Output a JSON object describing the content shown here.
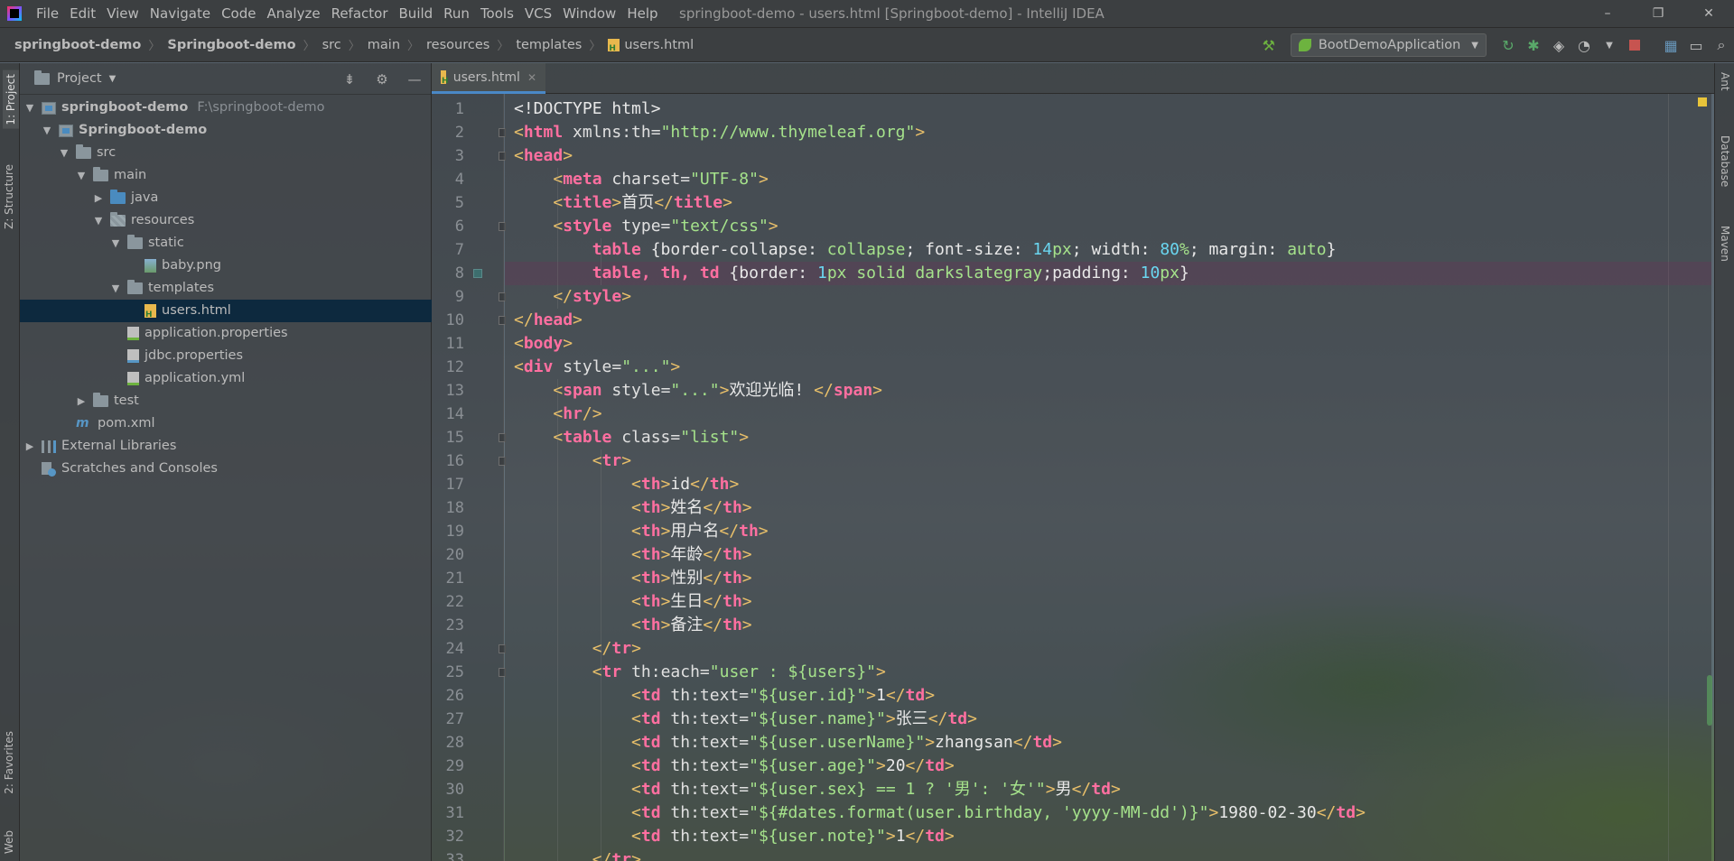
{
  "titlebar": {
    "menu": [
      "File",
      "Edit",
      "View",
      "Navigate",
      "Code",
      "Analyze",
      "Refactor",
      "Build",
      "Run",
      "Tools",
      "VCS",
      "Window",
      "Help"
    ],
    "window_title": "springboot-demo - users.html [Springboot-demo] - IntelliJ IDEA",
    "controls": [
      "–",
      "❐",
      "✕"
    ]
  },
  "breadcrumbs": [
    "springboot-demo",
    "Springboot-demo",
    "src",
    "main",
    "resources",
    "templates",
    "users.html"
  ],
  "run_config": {
    "label": "BootDemoApplication"
  },
  "toolbar_icons": [
    "build-hammer-icon",
    "rerun-icon",
    "debug-icon",
    "coverage-icon",
    "profile-icon",
    "stop-icon",
    "project-structure-icon",
    "window-layout-icon",
    "search-icon"
  ],
  "left_tabs": {
    "project": "1: Project",
    "structure": "Z: Structure",
    "favorites": "2: Favorites",
    "web": "Web"
  },
  "right_tabs": {
    "ant": "Ant",
    "database": "Database",
    "maven": "Maven"
  },
  "project_panel": {
    "title": "Project",
    "tree": [
      {
        "label": "springboot-demo",
        "hint": "F:\\springboot-demo",
        "depth": 0,
        "arrow": "▼",
        "icon": "module",
        "bold": true
      },
      {
        "label": "Springboot-demo",
        "depth": 1,
        "arrow": "▼",
        "icon": "module",
        "bold": true
      },
      {
        "label": "src",
        "depth": 2,
        "arrow": "▼",
        "icon": "folder"
      },
      {
        "label": "main",
        "depth": 3,
        "arrow": "▼",
        "icon": "folder"
      },
      {
        "label": "java",
        "depth": 4,
        "arrow": "▶",
        "icon": "folder-blue"
      },
      {
        "label": "resources",
        "depth": 4,
        "arrow": "▼",
        "icon": "folder-res"
      },
      {
        "label": "static",
        "depth": 5,
        "arrow": "▼",
        "icon": "folder"
      },
      {
        "label": "baby.png",
        "depth": 6,
        "arrow": "",
        "icon": "file-img"
      },
      {
        "label": "templates",
        "depth": 5,
        "arrow": "▼",
        "icon": "folder"
      },
      {
        "label": "users.html",
        "depth": 6,
        "arrow": "",
        "icon": "file-html",
        "selected": true
      },
      {
        "label": "application.properties",
        "depth": 5,
        "arrow": "",
        "icon": "file-prop"
      },
      {
        "label": "jdbc.properties",
        "depth": 5,
        "arrow": "",
        "icon": "file-prop2"
      },
      {
        "label": "application.yml",
        "depth": 5,
        "arrow": "",
        "icon": "file-yml"
      },
      {
        "label": "test",
        "depth": 3,
        "arrow": "▶",
        "icon": "folder"
      },
      {
        "label": "pom.xml",
        "depth": 2,
        "arrow": "",
        "icon": "maven"
      },
      {
        "label": "External Libraries",
        "depth": 0,
        "arrow": "▶",
        "icon": "libs"
      },
      {
        "label": "Scratches and Consoles",
        "depth": 0,
        "arrow": "",
        "icon": "scratch"
      }
    ]
  },
  "editor": {
    "tab_label": "users.html",
    "current_line": 8,
    "lines": [
      [
        [
          "<!DOCTYPE html>",
          "pu"
        ]
      ],
      [
        [
          "<",
          "t"
        ],
        [
          "html",
          "tn"
        ],
        [
          " xmlns:th=",
          "at"
        ],
        [
          "\"http://www.thymeleaf.org\"",
          "av"
        ],
        [
          ">",
          "t"
        ]
      ],
      [
        [
          "<",
          "t"
        ],
        [
          "head",
          "tn"
        ],
        [
          ">",
          "t"
        ]
      ],
      [
        [
          "    <",
          "t"
        ],
        [
          "meta",
          "tn"
        ],
        [
          " charset=",
          "at"
        ],
        [
          "\"UTF-8\"",
          "av"
        ],
        [
          ">",
          "t"
        ]
      ],
      [
        [
          "    <",
          "t"
        ],
        [
          "title",
          "tn"
        ],
        [
          ">",
          "t"
        ],
        [
          "首页",
          "pu"
        ],
        [
          "</",
          "t"
        ],
        [
          "title",
          "tn"
        ],
        [
          ">",
          "t"
        ]
      ],
      [
        [
          "    <",
          "t"
        ],
        [
          "style",
          "tn"
        ],
        [
          " type=",
          "at"
        ],
        [
          "\"text/css\"",
          "av"
        ],
        [
          ">",
          "t"
        ]
      ],
      [
        [
          "        table ",
          "tn"
        ],
        [
          "{border-collapse: ",
          "pu"
        ],
        [
          "collapse",
          "av"
        ],
        [
          "; font-size: ",
          "pu"
        ],
        [
          "14",
          "nm"
        ],
        [
          "px",
          "av"
        ],
        [
          "; width: ",
          "pu"
        ],
        [
          "80",
          "nm"
        ],
        [
          "%",
          "av"
        ],
        [
          "; margin: ",
          "pu"
        ],
        [
          "auto",
          "av"
        ],
        [
          "}",
          "pu"
        ]
      ],
      [
        [
          "        table, th, td ",
          "tn"
        ],
        [
          "{border: ",
          "pu"
        ],
        [
          "1",
          "nm"
        ],
        [
          "px solid darkslategray",
          "av"
        ],
        [
          ";padding: ",
          "pu"
        ],
        [
          "10",
          "nm"
        ],
        [
          "px",
          "av"
        ],
        [
          "}",
          "pu"
        ]
      ],
      [
        [
          "    </",
          "t"
        ],
        [
          "style",
          "tn"
        ],
        [
          ">",
          "t"
        ]
      ],
      [
        [
          "</",
          "t"
        ],
        [
          "head",
          "tn"
        ],
        [
          ">",
          "t"
        ]
      ],
      [
        [
          "<",
          "t"
        ],
        [
          "body",
          "tn"
        ],
        [
          ">",
          "t"
        ]
      ],
      [
        [
          "<",
          "t"
        ],
        [
          "div",
          "tn"
        ],
        [
          " style=",
          "at"
        ],
        [
          "\"...\"",
          "av"
        ],
        [
          ">",
          "t"
        ]
      ],
      [
        [
          "    <",
          "t"
        ],
        [
          "span",
          "tn"
        ],
        [
          " style=",
          "at"
        ],
        [
          "\"...\"",
          "av"
        ],
        [
          ">",
          "t"
        ],
        [
          "欢迎光临! ",
          "pu"
        ],
        [
          "</",
          "t"
        ],
        [
          "span",
          "tn"
        ],
        [
          ">",
          "t"
        ]
      ],
      [
        [
          "    <",
          "t"
        ],
        [
          "hr",
          "tn"
        ],
        [
          "/>",
          "t"
        ]
      ],
      [
        [
          "    <",
          "t"
        ],
        [
          "table",
          "tn"
        ],
        [
          " class=",
          "at"
        ],
        [
          "\"list\"",
          "av"
        ],
        [
          ">",
          "t"
        ]
      ],
      [
        [
          "        <",
          "t"
        ],
        [
          "tr",
          "tn"
        ],
        [
          ">",
          "t"
        ]
      ],
      [
        [
          "            <",
          "t"
        ],
        [
          "th",
          "tn"
        ],
        [
          ">",
          "t"
        ],
        [
          "id",
          "pu"
        ],
        [
          "</",
          "t"
        ],
        [
          "th",
          "tn"
        ],
        [
          ">",
          "t"
        ]
      ],
      [
        [
          "            <",
          "t"
        ],
        [
          "th",
          "tn"
        ],
        [
          ">",
          "t"
        ],
        [
          "姓名",
          "pu"
        ],
        [
          "</",
          "t"
        ],
        [
          "th",
          "tn"
        ],
        [
          ">",
          "t"
        ]
      ],
      [
        [
          "            <",
          "t"
        ],
        [
          "th",
          "tn"
        ],
        [
          ">",
          "t"
        ],
        [
          "用户名",
          "pu"
        ],
        [
          "</",
          "t"
        ],
        [
          "th",
          "tn"
        ],
        [
          ">",
          "t"
        ]
      ],
      [
        [
          "            <",
          "t"
        ],
        [
          "th",
          "tn"
        ],
        [
          ">",
          "t"
        ],
        [
          "年龄",
          "pu"
        ],
        [
          "</",
          "t"
        ],
        [
          "th",
          "tn"
        ],
        [
          ">",
          "t"
        ]
      ],
      [
        [
          "            <",
          "t"
        ],
        [
          "th",
          "tn"
        ],
        [
          ">",
          "t"
        ],
        [
          "性别",
          "pu"
        ],
        [
          "</",
          "t"
        ],
        [
          "th",
          "tn"
        ],
        [
          ">",
          "t"
        ]
      ],
      [
        [
          "            <",
          "t"
        ],
        [
          "th",
          "tn"
        ],
        [
          ">",
          "t"
        ],
        [
          "生日",
          "pu"
        ],
        [
          "</",
          "t"
        ],
        [
          "th",
          "tn"
        ],
        [
          ">",
          "t"
        ]
      ],
      [
        [
          "            <",
          "t"
        ],
        [
          "th",
          "tn"
        ],
        [
          ">",
          "t"
        ],
        [
          "备注",
          "pu"
        ],
        [
          "</",
          "t"
        ],
        [
          "th",
          "tn"
        ],
        [
          ">",
          "t"
        ]
      ],
      [
        [
          "        </",
          "t"
        ],
        [
          "tr",
          "tn"
        ],
        [
          ">",
          "t"
        ]
      ],
      [
        [
          "        <",
          "t"
        ],
        [
          "tr",
          "tn"
        ],
        [
          " th:each=",
          "at"
        ],
        [
          "\"user : ${users}\"",
          "av"
        ],
        [
          ">",
          "t"
        ]
      ],
      [
        [
          "            <",
          "t"
        ],
        [
          "td",
          "tn"
        ],
        [
          " th:text=",
          "at"
        ],
        [
          "\"${user.id}\"",
          "av"
        ],
        [
          ">",
          "t"
        ],
        [
          "1",
          "pu"
        ],
        [
          "</",
          "t"
        ],
        [
          "td",
          "tn"
        ],
        [
          ">",
          "t"
        ]
      ],
      [
        [
          "            <",
          "t"
        ],
        [
          "td",
          "tn"
        ],
        [
          " th:text=",
          "at"
        ],
        [
          "\"${user.name}\"",
          "av"
        ],
        [
          ">",
          "t"
        ],
        [
          "张三",
          "pu"
        ],
        [
          "</",
          "t"
        ],
        [
          "td",
          "tn"
        ],
        [
          ">",
          "t"
        ]
      ],
      [
        [
          "            <",
          "t"
        ],
        [
          "td",
          "tn"
        ],
        [
          " th:text=",
          "at"
        ],
        [
          "\"${user.userName}\"",
          "av"
        ],
        [
          ">",
          "t"
        ],
        [
          "zhangsan",
          "pu"
        ],
        [
          "</",
          "t"
        ],
        [
          "td",
          "tn"
        ],
        [
          ">",
          "t"
        ]
      ],
      [
        [
          "            <",
          "t"
        ],
        [
          "td",
          "tn"
        ],
        [
          " th:text=",
          "at"
        ],
        [
          "\"${user.age}\"",
          "av"
        ],
        [
          ">",
          "t"
        ],
        [
          "20",
          "pu"
        ],
        [
          "</",
          "t"
        ],
        [
          "td",
          "tn"
        ],
        [
          ">",
          "t"
        ]
      ],
      [
        [
          "            <",
          "t"
        ],
        [
          "td",
          "tn"
        ],
        [
          " th:text=",
          "at"
        ],
        [
          "\"${user.sex} == 1 ? '男': '女'\"",
          "av"
        ],
        [
          ">",
          "t"
        ],
        [
          "男",
          "pu"
        ],
        [
          "</",
          "t"
        ],
        [
          "td",
          "tn"
        ],
        [
          ">",
          "t"
        ]
      ],
      [
        [
          "            <",
          "t"
        ],
        [
          "td",
          "tn"
        ],
        [
          " th:text=",
          "at"
        ],
        [
          "\"${#dates.format(user.birthday, 'yyyy-MM-dd')}\"",
          "av"
        ],
        [
          ">",
          "t"
        ],
        [
          "1980-02-30",
          "pu"
        ],
        [
          "</",
          "t"
        ],
        [
          "td",
          "tn"
        ],
        [
          ">",
          "t"
        ]
      ],
      [
        [
          "            <",
          "t"
        ],
        [
          "td",
          "tn"
        ],
        [
          " th:text=",
          "at"
        ],
        [
          "\"${user.note}\"",
          "av"
        ],
        [
          ">",
          "t"
        ],
        [
          "1",
          "pu"
        ],
        [
          "</",
          "t"
        ],
        [
          "td",
          "tn"
        ],
        [
          ">",
          "t"
        ]
      ],
      [
        [
          "        </",
          "t"
        ],
        [
          "tr",
          "tn"
        ],
        [
          ">",
          "t"
        ]
      ]
    ]
  }
}
